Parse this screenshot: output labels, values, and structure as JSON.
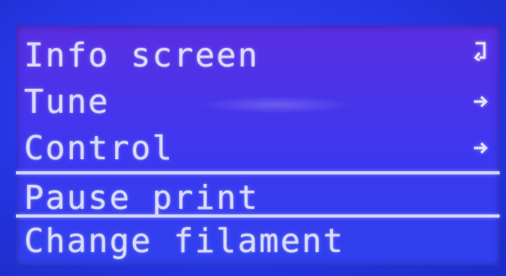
{
  "menu": {
    "items": [
      {
        "label": "Info screen",
        "icon": "back-arrow-icon"
      },
      {
        "label": "Tune",
        "icon": "submenu-arrow-icon"
      },
      {
        "label": "Control",
        "icon": "submenu-arrow-icon"
      },
      {
        "label": "Pause print",
        "icon": ""
      },
      {
        "label": "Change filament",
        "icon": ""
      }
    ]
  },
  "colors": {
    "bezel": "#2637e6",
    "screen": "#4a38ec",
    "text": "#d9dbff"
  }
}
